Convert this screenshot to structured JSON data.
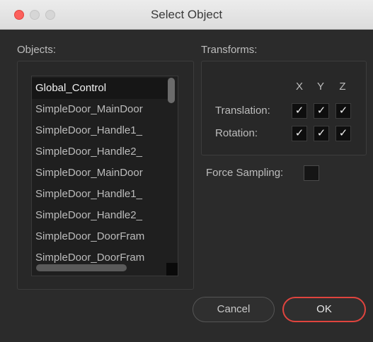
{
  "window": {
    "title": "Select Object"
  },
  "objects": {
    "label": "Objects:",
    "items": [
      "Global_Control",
      "SimpleDoor_MainDoor",
      "SimpleDoor_Handle1_",
      "SimpleDoor_Handle2_",
      "SimpleDoor_MainDoor",
      "SimpleDoor_Handle1_",
      "SimpleDoor_Handle2_",
      "SimpleDoor_DoorFram",
      "SimpleDoor_DoorFram"
    ],
    "selected_index": 0
  },
  "transforms": {
    "label": "Transforms:",
    "axes": [
      "X",
      "Y",
      "Z"
    ],
    "translation_label": "Translation:",
    "rotation_label": "Rotation:",
    "check_glyph": "✓",
    "translation": [
      true,
      true,
      true
    ],
    "rotation": [
      true,
      true,
      true
    ]
  },
  "force_sampling": {
    "label": "Force Sampling:",
    "checked": false
  },
  "buttons": {
    "cancel": "Cancel",
    "ok": "OK"
  },
  "colors": {
    "close": "#fc605c",
    "ok_border": "#e0443e"
  }
}
